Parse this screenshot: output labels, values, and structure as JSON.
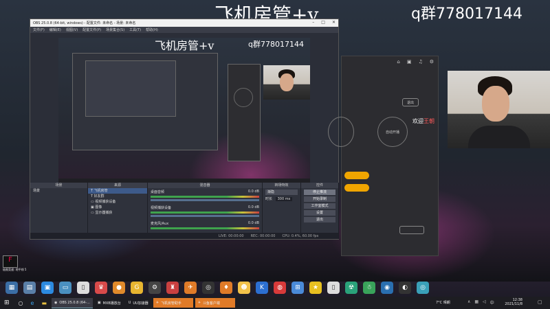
{
  "stream_overlay": {
    "title": "飞机房管+v",
    "qq_group": "q群778017144"
  },
  "obs": {
    "window_title": "OBS 25.0.8 (64-bit, windows) - 配置文件: 未命名 - 场景: 未命名",
    "menu": [
      "文件(F)",
      "编辑(E)",
      "视图(V)",
      "配置文件(P)",
      "场景集合(S)",
      "工具(T)",
      "帮助(H)"
    ],
    "preview": {
      "title": "飞机房管+v",
      "qq_group": "q群778017144"
    },
    "docks": {
      "scenes": {
        "header": "场景",
        "items": [
          "场景"
        ]
      },
      "sources": {
        "header": "来源",
        "items": [
          "飞机房管",
          "好友群",
          "视频捕获设备",
          "图像",
          "显示器捕获"
        ]
      },
      "mixer": {
        "header": "混音器",
        "channels": [
          {
            "name": "桌面音频",
            "db": "0.0 dB"
          },
          {
            "name": "视频捕获设备",
            "db": "0.0 dB"
          },
          {
            "name": "麦克风/Aux",
            "db": "0.0 dB"
          }
        ]
      },
      "transitions": {
        "header": "转场特效",
        "type": "渐隐",
        "duration_label": "时长",
        "duration_value": "300 ms"
      },
      "controls": {
        "header": "控件",
        "buttons": [
          "停止推流",
          "开始录制",
          "工作室模式",
          "设置",
          "退出"
        ]
      }
    },
    "status": {
      "live": "LIVE: 00:00:00",
      "rec": "REC: 00:00:00",
      "cpu": "CPU: 0.4%, 60.00 fps"
    }
  },
  "live_app": {
    "exit_label": "退出",
    "auto_volume_label": "自动开播",
    "welcome": "欢迎",
    "highlight_name": "王朝",
    "icons": [
      "home-icon",
      "gift-icon",
      "bell-icon",
      "settings-icon"
    ]
  },
  "desktop": {
    "game_icon_label": "极限竞速: 地平线 5"
  },
  "taskbar": {
    "items": [
      {
        "label": "OBS 25.0.8 (64-...",
        "active": true
      },
      {
        "label": "MXB播放台",
        "active": false
      },
      {
        "label": "UU加速器",
        "active": false
      },
      {
        "label": "飞机房管助手",
        "active": false,
        "accent": true
      },
      {
        "label": "斗鱼客户端",
        "active": false,
        "accent": true
      }
    ],
    "weather": "7°C 晴朗",
    "time": "12:38",
    "date": "2021/11/8"
  },
  "colors": {
    "accent": "#f0a500",
    "obs_bg": "#2b2e38",
    "taskbar_bg": "#1d1d22"
  }
}
